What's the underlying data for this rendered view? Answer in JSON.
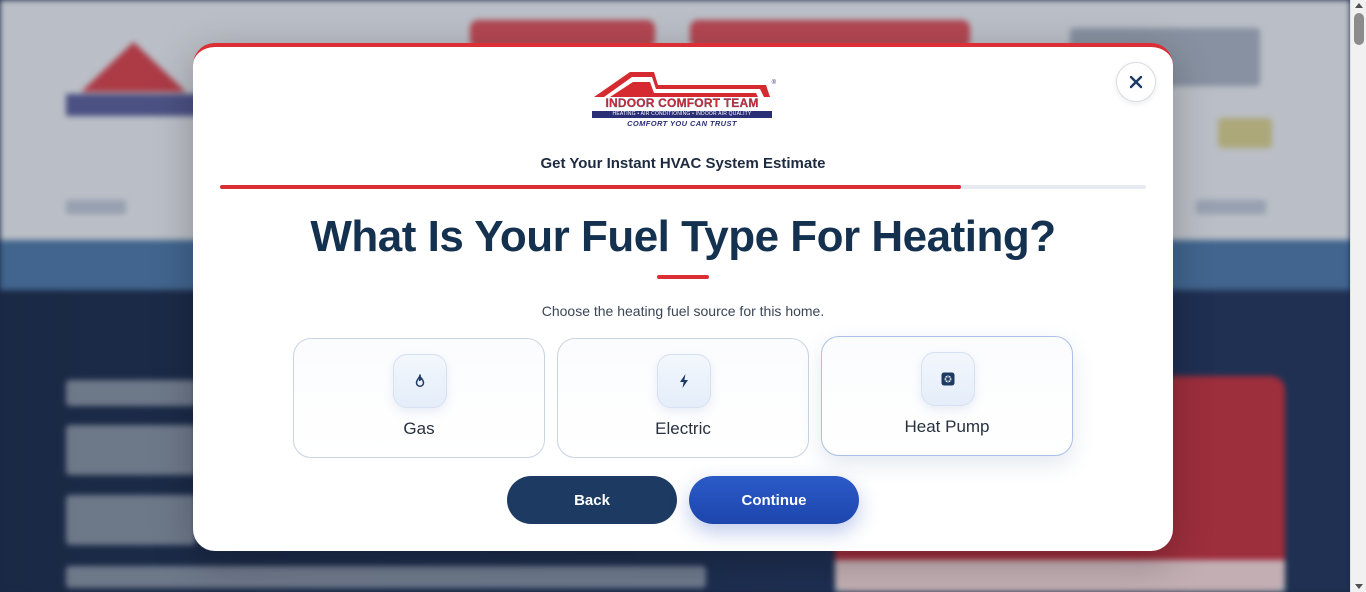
{
  "modal": {
    "logo": {
      "brand": "INDOOR COMFORT TEAM",
      "tagline": "HEATING • AIR CONDITIONING • INDOOR AIR QUALITY",
      "slogan": "COMFORT YOU CAN TRUST",
      "registered": "®"
    },
    "subtitle": "Get Your Instant HVAC System Estimate",
    "progress_fraction": 0.8,
    "question": "What Is Your Fuel Type For Heating?",
    "helper": "Choose the heating fuel source for this home.",
    "options": [
      {
        "label": "Gas",
        "icon": "flame-icon",
        "selected": false
      },
      {
        "label": "Electric",
        "icon": "lightning-icon",
        "selected": false
      },
      {
        "label": "Heat Pump",
        "icon": "heat-pump-icon",
        "selected": false
      }
    ],
    "back_label": "Back",
    "continue_label": "Continue",
    "close_icon": "close-icon"
  },
  "colors": {
    "accent_red": "#dc2f35",
    "navy": "#14314f",
    "button_back": "#1d3a62",
    "button_continue": "#1d46ad"
  }
}
